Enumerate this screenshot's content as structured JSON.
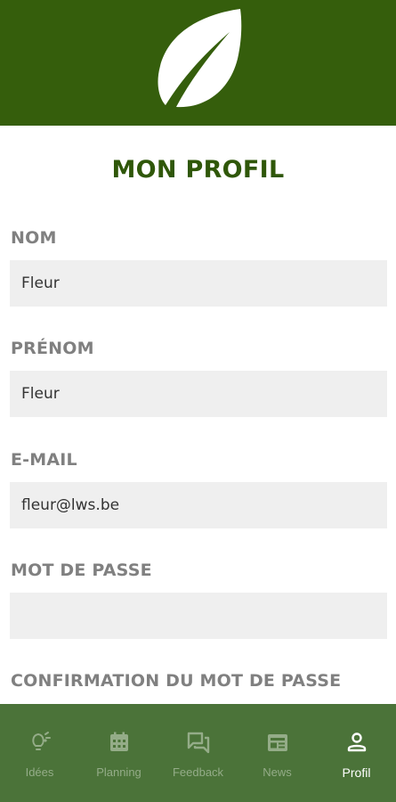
{
  "header": {
    "logo_icon": "leaf-icon",
    "background_color": "#355e0c"
  },
  "page": {
    "title": "MON PROFIL"
  },
  "form": {
    "fields": [
      {
        "label": "NOM",
        "value": "Fleur"
      },
      {
        "label": "PRÉNOM",
        "value": "Fleur"
      },
      {
        "label": "E-MAIL",
        "value": "fleur@lws.be"
      },
      {
        "label": "MOT DE PASSE",
        "value": ""
      },
      {
        "label": "CONFIRMATION DU MOT DE PASSE"
      }
    ]
  },
  "bottom_nav": {
    "background_color": "#4b7339",
    "active": "Profil",
    "items": [
      {
        "label": "Idées",
        "icon": "lightbulb-icon"
      },
      {
        "label": "Planning",
        "icon": "calendar-icon"
      },
      {
        "label": "Feedback",
        "icon": "chat-bubbles-icon"
      },
      {
        "label": "News",
        "icon": "newspaper-icon"
      },
      {
        "label": "Profil",
        "icon": "person-icon"
      }
    ]
  }
}
